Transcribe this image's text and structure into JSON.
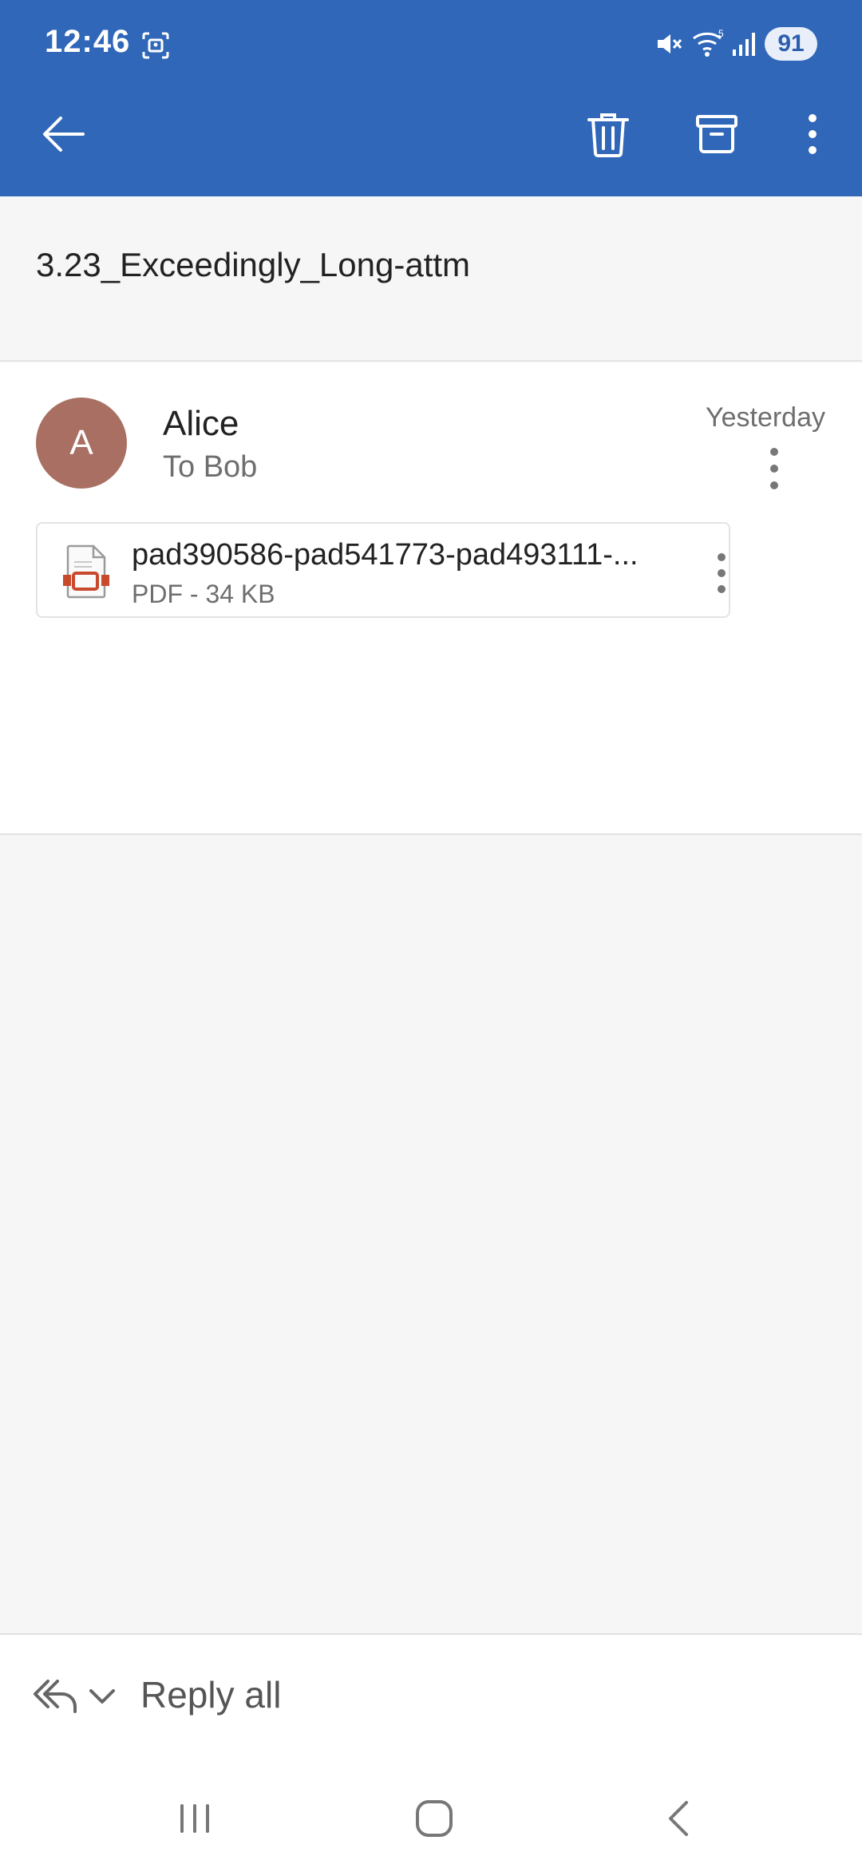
{
  "status_bar": {
    "time": "12:46",
    "battery": "91",
    "icons": [
      "screenshot-icon",
      "mute-icon",
      "wifi-icon",
      "signal-icon"
    ]
  },
  "toolbar": {
    "back_icon": "back-arrow-icon",
    "delete_icon": "trash-icon",
    "archive_icon": "archive-icon",
    "more_icon": "more-vertical-icon",
    "color": "#3067b9"
  },
  "email": {
    "subject": "3.23_Exceedingly_Long-attm",
    "sender_initial": "A",
    "sender": "Alice",
    "recipient": "To Bob",
    "date": "Yesterday",
    "avatar_color": "#a86f62"
  },
  "attachment": {
    "name": "pad390586-pad541773-pad493111-...",
    "meta": "PDF - 34 KB",
    "icon": "pdf-file-icon"
  },
  "reply": {
    "label": "Reply all"
  },
  "nav": {
    "recents_icon": "recents-icon",
    "home_icon": "home-icon",
    "back_icon": "nav-back-icon"
  }
}
